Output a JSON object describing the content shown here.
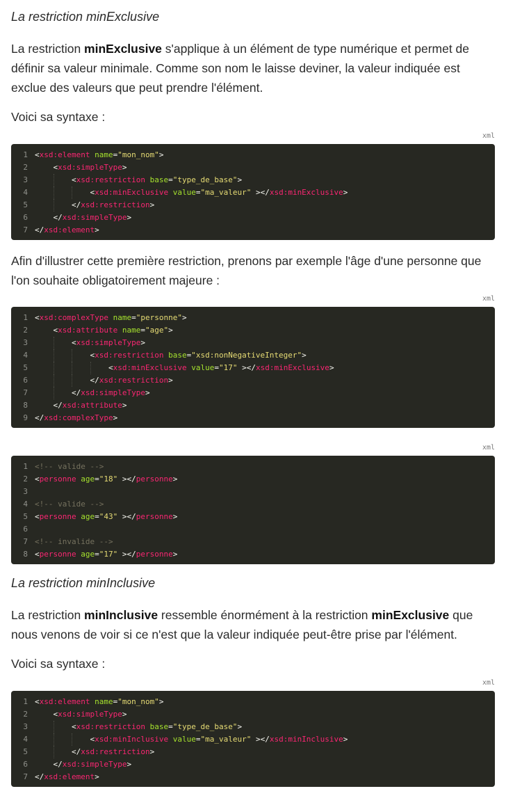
{
  "section1": {
    "heading": "La restriction minExclusive",
    "intro_pre": "La restriction ",
    "intro_bold": "minExclusive",
    "intro_post": " s'applique à un élément de type numérique et permet de définir sa valeur minimale. Comme son nom le laisse deviner, la valeur indiquée est exclue des valeurs que peut prendre l'élément.",
    "syntax_label": "Voici sa syntaxe :",
    "code_lang": "xml",
    "code_lines": [
      {
        "n": "1",
        "indent": 0,
        "tokens": [
          [
            "p",
            "<"
          ],
          [
            "t",
            "xsd:element"
          ],
          [
            "p",
            " "
          ],
          [
            "a",
            "name"
          ],
          [
            "p",
            "="
          ],
          [
            "s",
            "\"mon_nom\""
          ],
          [
            "p",
            ">"
          ]
        ]
      },
      {
        "n": "2",
        "indent": 1,
        "tokens": [
          [
            "p",
            "<"
          ],
          [
            "t",
            "xsd:simpleType"
          ],
          [
            "p",
            ">"
          ]
        ]
      },
      {
        "n": "3",
        "indent": 2,
        "tokens": [
          [
            "p",
            "<"
          ],
          [
            "t",
            "xsd:restriction"
          ],
          [
            "p",
            " "
          ],
          [
            "a",
            "base"
          ],
          [
            "p",
            "="
          ],
          [
            "s",
            "\"type_de_base\""
          ],
          [
            "p",
            ">"
          ]
        ]
      },
      {
        "n": "4",
        "indent": 3,
        "tokens": [
          [
            "p",
            "<"
          ],
          [
            "t",
            "xsd:minExclusive"
          ],
          [
            "p",
            " "
          ],
          [
            "a",
            "value"
          ],
          [
            "p",
            "="
          ],
          [
            "s",
            "\"ma_valeur\""
          ],
          [
            "p",
            " ></"
          ],
          [
            "t",
            "xsd:minExclusive"
          ],
          [
            "p",
            ">"
          ]
        ]
      },
      {
        "n": "5",
        "indent": 2,
        "tokens": [
          [
            "p",
            "</"
          ],
          [
            "t",
            "xsd:restriction"
          ],
          [
            "p",
            ">"
          ]
        ]
      },
      {
        "n": "6",
        "indent": 1,
        "tokens": [
          [
            "p",
            "</"
          ],
          [
            "t",
            "xsd:simpleType"
          ],
          [
            "p",
            ">"
          ]
        ]
      },
      {
        "n": "7",
        "indent": 0,
        "tokens": [
          [
            "p",
            "</"
          ],
          [
            "t",
            "xsd:element"
          ],
          [
            "p",
            ">"
          ]
        ]
      }
    ],
    "example_intro": "Afin d'illustrer cette première restriction, prenons par exemple l'âge d'une personne que l'on souhaite obligatoirement majeure :",
    "example_lang": "xml",
    "example_lines": [
      {
        "n": "1",
        "indent": 0,
        "tokens": [
          [
            "p",
            "<"
          ],
          [
            "t",
            "xsd:complexType"
          ],
          [
            "p",
            " "
          ],
          [
            "a",
            "name"
          ],
          [
            "p",
            "="
          ],
          [
            "s",
            "\"personne\""
          ],
          [
            "p",
            ">"
          ]
        ]
      },
      {
        "n": "2",
        "indent": 1,
        "tokens": [
          [
            "p",
            "<"
          ],
          [
            "t",
            "xsd:attribute"
          ],
          [
            "p",
            " "
          ],
          [
            "a",
            "name"
          ],
          [
            "p",
            "="
          ],
          [
            "s",
            "\"age\""
          ],
          [
            "p",
            ">"
          ]
        ]
      },
      {
        "n": "3",
        "indent": 2,
        "tokens": [
          [
            "p",
            "<"
          ],
          [
            "t",
            "xsd:simpleType"
          ],
          [
            "p",
            ">"
          ]
        ]
      },
      {
        "n": "4",
        "indent": 3,
        "tokens": [
          [
            "p",
            "<"
          ],
          [
            "t",
            "xsd:restriction"
          ],
          [
            "p",
            " "
          ],
          [
            "a",
            "base"
          ],
          [
            "p",
            "="
          ],
          [
            "s",
            "\"xsd:nonNegativeInteger\""
          ],
          [
            "p",
            ">"
          ]
        ]
      },
      {
        "n": "5",
        "indent": 4,
        "tokens": [
          [
            "p",
            "<"
          ],
          [
            "t",
            "xsd:minExclusive"
          ],
          [
            "p",
            " "
          ],
          [
            "a",
            "value"
          ],
          [
            "p",
            "="
          ],
          [
            "s",
            "\"17\""
          ],
          [
            "p",
            " ></"
          ],
          [
            "t",
            "xsd:minExclusive"
          ],
          [
            "p",
            ">"
          ]
        ]
      },
      {
        "n": "6",
        "indent": 3,
        "tokens": [
          [
            "p",
            "</"
          ],
          [
            "t",
            "xsd:restriction"
          ],
          [
            "p",
            ">"
          ]
        ]
      },
      {
        "n": "7",
        "indent": 2,
        "tokens": [
          [
            "p",
            "</"
          ],
          [
            "t",
            "xsd:simpleType"
          ],
          [
            "p",
            ">"
          ]
        ]
      },
      {
        "n": "8",
        "indent": 1,
        "tokens": [
          [
            "p",
            "</"
          ],
          [
            "t",
            "xsd:attribute"
          ],
          [
            "p",
            ">"
          ]
        ]
      },
      {
        "n": "9",
        "indent": 0,
        "tokens": [
          [
            "p",
            "</"
          ],
          [
            "t",
            "xsd:complexType"
          ],
          [
            "p",
            ">"
          ]
        ]
      }
    ],
    "instances_lang": "xml",
    "instances_lines": [
      {
        "n": "1",
        "indent": 0,
        "tokens": [
          [
            "c",
            "<!-- valide -->"
          ]
        ]
      },
      {
        "n": "2",
        "indent": 0,
        "tokens": [
          [
            "p",
            "<"
          ],
          [
            "t",
            "personne"
          ],
          [
            "p",
            " "
          ],
          [
            "a",
            "age"
          ],
          [
            "p",
            "="
          ],
          [
            "s",
            "\"18\""
          ],
          [
            "p",
            " ></"
          ],
          [
            "t",
            "personne"
          ],
          [
            "p",
            ">"
          ]
        ]
      },
      {
        "n": "3",
        "indent": 0,
        "tokens": []
      },
      {
        "n": "4",
        "indent": 0,
        "tokens": [
          [
            "c",
            "<!-- valide -->"
          ]
        ]
      },
      {
        "n": "5",
        "indent": 0,
        "tokens": [
          [
            "p",
            "<"
          ],
          [
            "t",
            "personne"
          ],
          [
            "p",
            " "
          ],
          [
            "a",
            "age"
          ],
          [
            "p",
            "="
          ],
          [
            "s",
            "\"43\""
          ],
          [
            "p",
            " ></"
          ],
          [
            "t",
            "personne"
          ],
          [
            "p",
            ">"
          ]
        ]
      },
      {
        "n": "6",
        "indent": 0,
        "tokens": []
      },
      {
        "n": "7",
        "indent": 0,
        "tokens": [
          [
            "c",
            "<!-- invalide -->"
          ]
        ]
      },
      {
        "n": "8",
        "indent": 0,
        "tokens": [
          [
            "p",
            "<"
          ],
          [
            "t",
            "personne"
          ],
          [
            "p",
            " "
          ],
          [
            "a",
            "age"
          ],
          [
            "p",
            "="
          ],
          [
            "s",
            "\"17\""
          ],
          [
            "p",
            " ></"
          ],
          [
            "t",
            "personne"
          ],
          [
            "p",
            ">"
          ]
        ]
      }
    ]
  },
  "section2": {
    "heading": "La restriction minInclusive",
    "intro_pre": "La restriction ",
    "intro_bold1": "minInclusive",
    "intro_mid": " ressemble énormément à la restriction ",
    "intro_bold2": "minExclusive",
    "intro_post": " que nous venons de voir si ce n'est que la valeur indiquée peut-être prise par l'élément.",
    "syntax_label": "Voici sa syntaxe :",
    "code_lang": "xml",
    "code_lines": [
      {
        "n": "1",
        "indent": 0,
        "tokens": [
          [
            "p",
            "<"
          ],
          [
            "t",
            "xsd:element"
          ],
          [
            "p",
            " "
          ],
          [
            "a",
            "name"
          ],
          [
            "p",
            "="
          ],
          [
            "s",
            "\"mon_nom\""
          ],
          [
            "p",
            ">"
          ]
        ]
      },
      {
        "n": "2",
        "indent": 1,
        "tokens": [
          [
            "p",
            "<"
          ],
          [
            "t",
            "xsd:simpleType"
          ],
          [
            "p",
            ">"
          ]
        ]
      },
      {
        "n": "3",
        "indent": 2,
        "tokens": [
          [
            "p",
            "<"
          ],
          [
            "t",
            "xsd:restriction"
          ],
          [
            "p",
            " "
          ],
          [
            "a",
            "base"
          ],
          [
            "p",
            "="
          ],
          [
            "s",
            "\"type_de_base\""
          ],
          [
            "p",
            ">"
          ]
        ]
      },
      {
        "n": "4",
        "indent": 3,
        "tokens": [
          [
            "p",
            "<"
          ],
          [
            "t",
            "xsd:minInclusive"
          ],
          [
            "p",
            " "
          ],
          [
            "a",
            "value"
          ],
          [
            "p",
            "="
          ],
          [
            "s",
            "\"ma_valeur\""
          ],
          [
            "p",
            " ></"
          ],
          [
            "t",
            "xsd:minInclusive"
          ],
          [
            "p",
            ">"
          ]
        ]
      },
      {
        "n": "5",
        "indent": 2,
        "tokens": [
          [
            "p",
            "</"
          ],
          [
            "t",
            "xsd:restriction"
          ],
          [
            "p",
            ">"
          ]
        ]
      },
      {
        "n": "6",
        "indent": 1,
        "tokens": [
          [
            "p",
            "</"
          ],
          [
            "t",
            "xsd:simpleType"
          ],
          [
            "p",
            ">"
          ]
        ]
      },
      {
        "n": "7",
        "indent": 0,
        "tokens": [
          [
            "p",
            "</"
          ],
          [
            "t",
            "xsd:element"
          ],
          [
            "p",
            ">"
          ]
        ]
      }
    ]
  }
}
